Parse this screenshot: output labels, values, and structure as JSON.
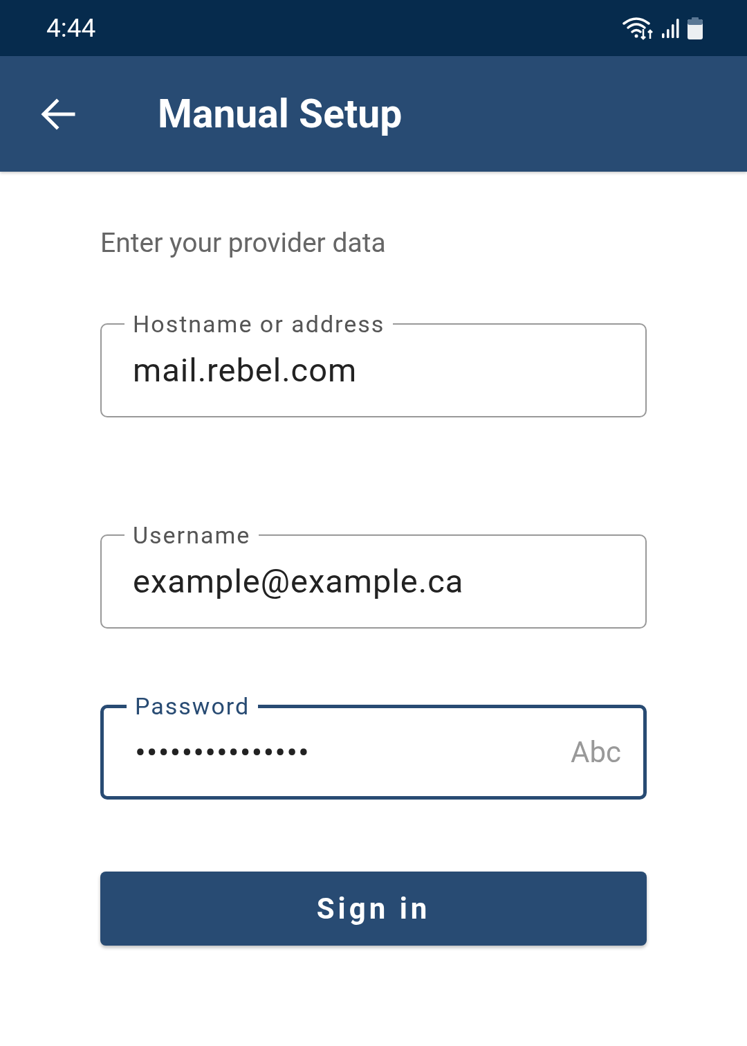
{
  "status_bar": {
    "time": "4:44"
  },
  "app_bar": {
    "title": "Manual Setup"
  },
  "subtitle": "Enter your provider data",
  "fields": [
    {
      "label": "Hostname or address",
      "value": "mail.rebel.com",
      "focused": false
    },
    {
      "label": "Username",
      "value": "example@example.ca",
      "focused": false
    },
    {
      "label": "Password",
      "value": "•••••••••••••••",
      "suffix": "Abc",
      "focused": true
    }
  ],
  "button": {
    "label": "Sign in"
  }
}
